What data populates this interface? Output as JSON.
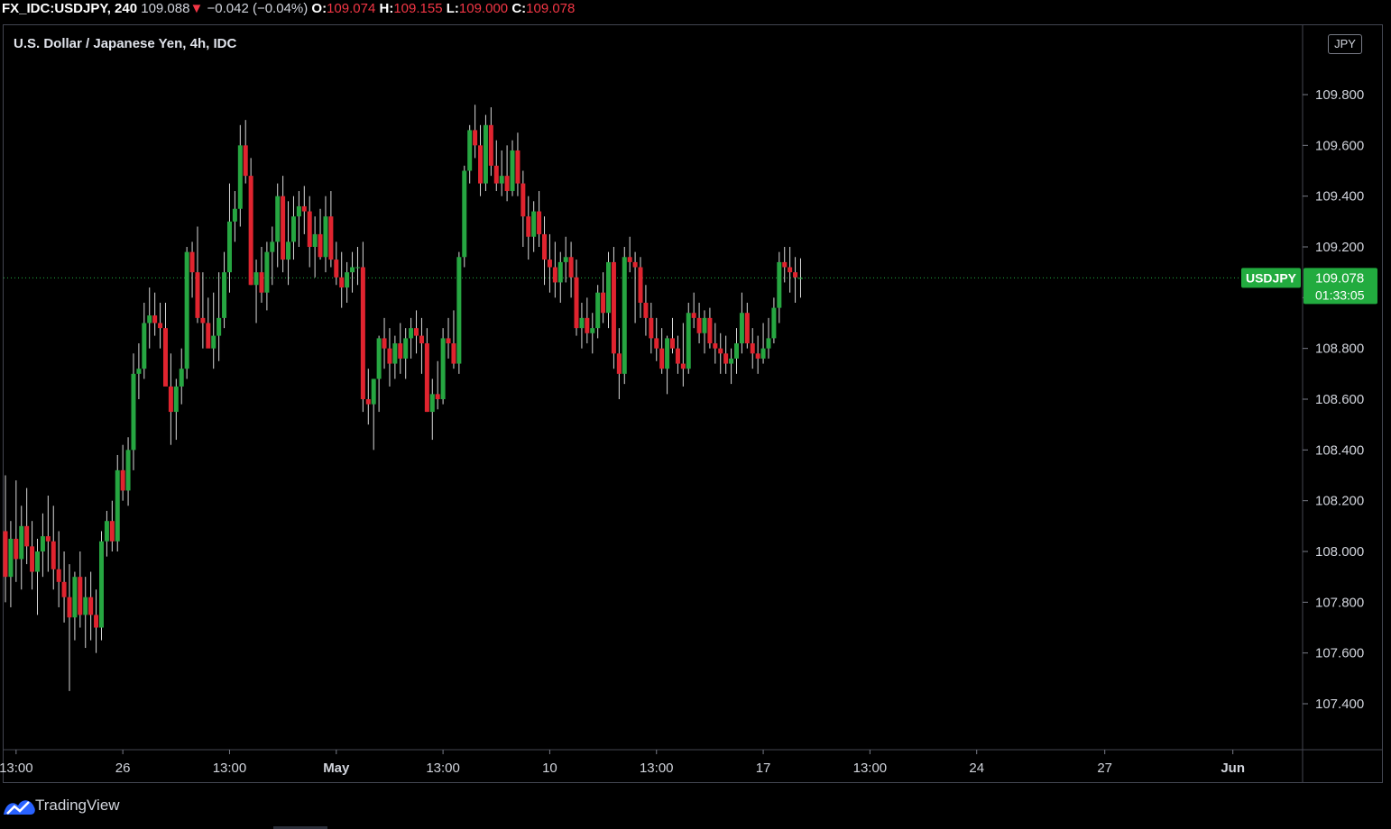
{
  "header": {
    "symbol": "FX_IDC:USDJPY, 240",
    "last": "109.088",
    "arrow": "▼",
    "change": "−0.042 (−0.04%)",
    "o_label": "O:",
    "o": "109.074",
    "h_label": "H:",
    "h": "109.155",
    "l_label": "L:",
    "l": "109.000",
    "c_label": "C:",
    "c": "109.078"
  },
  "chart_title": "U.S. Dollar / Japanese Yen, 4h, IDC",
  "currency_badge": "JPY",
  "brand": "TradingView",
  "colors": {
    "up": "#26a641",
    "down": "#e0242f",
    "wick": "#d9d9d9",
    "badge": "#22ab3f",
    "background": "#000000"
  },
  "chart_data": {
    "type": "candlestick",
    "ylim": [
      107.2,
      110.0
    ],
    "yticks": [
      107.4,
      107.6,
      107.8,
      108.0,
      108.2,
      108.4,
      108.6,
      108.8,
      109.0,
      109.2,
      109.4,
      109.6,
      109.8
    ],
    "ytick_labels": [
      "107.400",
      "107.600",
      "107.800",
      "108.000",
      "108.200",
      "108.400",
      "108.600",
      "108.800",
      "109.000",
      "109.200",
      "109.400",
      "109.600",
      "109.800"
    ],
    "xticks": [
      {
        "label": "13:00",
        "i": 2
      },
      {
        "label": "26",
        "i": 22
      },
      {
        "label": "13:00",
        "i": 42
      },
      {
        "label": "May",
        "i": 62
      },
      {
        "label": "13:00",
        "i": 82
      },
      {
        "label": "10",
        "i": 102
      },
      {
        "label": "13:00",
        "i": 122
      },
      {
        "label": "17",
        "i": 142
      },
      {
        "label": "13:00",
        "i": 162
      },
      {
        "label": "24",
        "i": 182
      },
      {
        "label": "27",
        "i": 206
      },
      {
        "label": "Jun",
        "i": 230
      }
    ],
    "last_price": {
      "symbol": "USDJPY",
      "value": "109.078",
      "countdown": "01:33:05",
      "y": 109.078
    },
    "candles": [
      [
        108.08,
        108.3,
        107.8,
        107.9
      ],
      [
        107.9,
        108.12,
        107.78,
        108.05
      ],
      [
        108.05,
        108.28,
        107.88,
        107.97
      ],
      [
        107.97,
        108.18,
        107.85,
        108.1
      ],
      [
        108.1,
        108.25,
        107.95,
        108.02
      ],
      [
        108.02,
        108.12,
        107.85,
        107.92
      ],
      [
        107.92,
        108.05,
        107.75,
        108.0
      ],
      [
        108.0,
        108.15,
        107.9,
        108.06
      ],
      [
        108.06,
        108.22,
        107.92,
        108.04
      ],
      [
        108.04,
        108.18,
        107.85,
        107.93
      ],
      [
        107.93,
        108.08,
        107.78,
        107.88
      ],
      [
        107.88,
        108.0,
        107.72,
        107.82
      ],
      [
        107.82,
        107.95,
        107.45,
        107.74
      ],
      [
        107.74,
        107.92,
        107.65,
        107.9
      ],
      [
        107.9,
        108.0,
        107.7,
        107.75
      ],
      [
        107.75,
        107.9,
        107.62,
        107.82
      ],
      [
        107.82,
        107.92,
        107.65,
        107.75
      ],
      [
        107.75,
        107.85,
        107.6,
        107.7
      ],
      [
        107.7,
        108.08,
        107.65,
        108.04
      ],
      [
        108.04,
        108.16,
        107.98,
        108.12
      ],
      [
        108.12,
        108.2,
        108.0,
        108.04
      ],
      [
        108.04,
        108.38,
        108.0,
        108.32
      ],
      [
        108.32,
        108.42,
        108.2,
        108.24
      ],
      [
        108.24,
        108.45,
        108.18,
        108.4
      ],
      [
        108.4,
        108.78,
        108.32,
        108.7
      ],
      [
        108.7,
        108.82,
        108.6,
        108.72
      ],
      [
        108.72,
        108.98,
        108.68,
        108.9
      ],
      [
        108.9,
        109.04,
        108.8,
        108.93
      ],
      [
        108.93,
        109.02,
        108.85,
        108.9
      ],
      [
        108.9,
        108.98,
        108.8,
        108.88
      ],
      [
        108.88,
        108.98,
        108.72,
        108.65
      ],
      [
        108.65,
        108.78,
        108.42,
        108.55
      ],
      [
        108.55,
        108.68,
        108.44,
        108.65
      ],
      [
        108.65,
        108.8,
        108.58,
        108.72
      ],
      [
        108.72,
        109.2,
        108.68,
        109.18
      ],
      [
        109.18,
        109.22,
        109.0,
        109.1
      ],
      [
        109.1,
        109.28,
        108.9,
        108.92
      ],
      [
        108.92,
        109.1,
        108.8,
        108.9
      ],
      [
        108.9,
        109.0,
        108.82,
        108.8
      ],
      [
        108.8,
        109.02,
        108.72,
        108.85
      ],
      [
        108.85,
        109.1,
        108.75,
        108.92
      ],
      [
        108.92,
        109.18,
        108.88,
        109.1
      ],
      [
        109.1,
        109.45,
        109.02,
        109.3
      ],
      [
        109.3,
        109.42,
        109.22,
        109.35
      ],
      [
        109.35,
        109.68,
        109.28,
        109.6
      ],
      [
        109.6,
        109.7,
        109.45,
        109.48
      ],
      [
        109.48,
        109.55,
        109.05,
        109.05
      ],
      [
        109.05,
        109.15,
        108.9,
        109.1
      ],
      [
        109.1,
        109.2,
        108.98,
        109.02
      ],
      [
        109.02,
        109.22,
        108.95,
        109.18
      ],
      [
        109.18,
        109.28,
        109.05,
        109.22
      ],
      [
        109.22,
        109.45,
        109.12,
        109.4
      ],
      [
        109.4,
        109.48,
        109.1,
        109.15
      ],
      [
        109.15,
        109.38,
        109.05,
        109.22
      ],
      [
        109.22,
        109.4,
        109.15,
        109.32
      ],
      [
        109.32,
        109.42,
        109.2,
        109.36
      ],
      [
        109.36,
        109.44,
        109.25,
        109.34
      ],
      [
        109.34,
        109.4,
        109.12,
        109.2
      ],
      [
        109.2,
        109.32,
        109.08,
        109.25
      ],
      [
        109.25,
        109.35,
        109.15,
        109.16
      ],
      [
        109.16,
        109.4,
        109.1,
        109.32
      ],
      [
        109.32,
        109.42,
        109.12,
        109.15
      ],
      [
        109.15,
        109.22,
        109.05,
        109.08
      ],
      [
        109.08,
        109.18,
        108.96,
        109.04
      ],
      [
        109.04,
        109.14,
        108.98,
        109.1
      ],
      [
        109.1,
        109.18,
        109.02,
        109.12
      ],
      [
        109.12,
        109.2,
        109.05,
        109.12
      ],
      [
        109.12,
        109.22,
        108.55,
        108.6
      ],
      [
        108.6,
        108.72,
        108.5,
        108.58
      ],
      [
        108.58,
        108.68,
        108.4,
        108.68
      ],
      [
        108.68,
        108.85,
        108.55,
        108.84
      ],
      [
        108.84,
        108.92,
        108.72,
        108.8
      ],
      [
        108.8,
        108.88,
        108.65,
        108.74
      ],
      [
        108.74,
        108.85,
        108.68,
        108.82
      ],
      [
        108.82,
        108.9,
        108.7,
        108.76
      ],
      [
        108.76,
        108.88,
        108.68,
        108.84
      ],
      [
        108.84,
        108.92,
        108.76,
        108.88
      ],
      [
        108.88,
        108.95,
        108.78,
        108.85
      ],
      [
        108.85,
        108.92,
        108.7,
        108.82
      ],
      [
        108.82,
        108.88,
        108.55,
        108.55
      ],
      [
        108.55,
        108.68,
        108.44,
        108.62
      ],
      [
        108.62,
        108.75,
        108.56,
        108.6
      ],
      [
        108.6,
        108.88,
        108.58,
        108.84
      ],
      [
        108.84,
        108.92,
        108.76,
        108.82
      ],
      [
        108.82,
        108.95,
        108.72,
        108.74
      ],
      [
        108.74,
        109.18,
        108.7,
        109.16
      ],
      [
        109.16,
        109.52,
        109.12,
        109.5
      ],
      [
        109.5,
        109.68,
        109.45,
        109.66
      ],
      [
        109.66,
        109.76,
        109.55,
        109.6
      ],
      [
        109.6,
        109.68,
        109.4,
        109.45
      ],
      [
        109.45,
        109.72,
        109.42,
        109.68
      ],
      [
        109.68,
        109.75,
        109.48,
        109.52
      ],
      [
        109.52,
        109.62,
        109.42,
        109.45
      ],
      [
        109.45,
        109.58,
        109.4,
        109.48
      ],
      [
        109.48,
        109.6,
        109.38,
        109.42
      ],
      [
        109.42,
        109.62,
        109.4,
        109.58
      ],
      [
        109.58,
        109.65,
        109.4,
        109.45
      ],
      [
        109.45,
        109.5,
        109.2,
        109.32
      ],
      [
        109.32,
        109.4,
        109.15,
        109.24
      ],
      [
        109.24,
        109.38,
        109.18,
        109.34
      ],
      [
        109.34,
        109.42,
        109.2,
        109.25
      ],
      [
        109.25,
        109.32,
        109.05,
        109.15
      ],
      [
        109.15,
        109.25,
        109.02,
        109.12
      ],
      [
        109.12,
        109.22,
        109.0,
        109.06
      ],
      [
        109.06,
        109.18,
        108.98,
        109.14
      ],
      [
        109.14,
        109.24,
        109.06,
        109.16
      ],
      [
        109.16,
        109.22,
        109.0,
        109.08
      ],
      [
        109.08,
        109.15,
        108.85,
        108.88
      ],
      [
        108.88,
        108.98,
        108.8,
        108.92
      ],
      [
        108.92,
        109.0,
        108.82,
        108.86
      ],
      [
        108.86,
        108.94,
        108.78,
        108.88
      ],
      [
        108.88,
        109.05,
        108.84,
        109.02
      ],
      [
        109.02,
        109.1,
        108.9,
        108.94
      ],
      [
        108.94,
        109.18,
        108.88,
        109.14
      ],
      [
        109.14,
        109.2,
        108.72,
        108.78
      ],
      [
        108.78,
        108.88,
        108.6,
        108.7
      ],
      [
        108.7,
        109.2,
        108.66,
        109.16
      ],
      [
        109.16,
        109.24,
        109.1,
        109.14
      ],
      [
        109.14,
        109.18,
        108.9,
        109.12
      ],
      [
        109.12,
        109.16,
        108.92,
        108.98
      ],
      [
        108.98,
        109.05,
        108.85,
        108.92
      ],
      [
        108.92,
        108.98,
        108.78,
        108.84
      ],
      [
        108.84,
        108.92,
        108.75,
        108.8
      ],
      [
        108.8,
        108.88,
        108.7,
        108.72
      ],
      [
        108.72,
        108.85,
        108.62,
        108.84
      ],
      [
        108.84,
        108.92,
        108.78,
        108.8
      ],
      [
        108.8,
        108.85,
        108.7,
        108.74
      ],
      [
        108.74,
        108.9,
        108.65,
        108.72
      ],
      [
        108.72,
        108.98,
        108.7,
        108.94
      ],
      [
        108.94,
        109.02,
        108.88,
        108.92
      ],
      [
        108.92,
        108.98,
        108.82,
        108.86
      ],
      [
        108.86,
        108.95,
        108.78,
        108.92
      ],
      [
        108.92,
        108.96,
        108.8,
        108.82
      ],
      [
        108.82,
        108.9,
        108.74,
        108.8
      ],
      [
        108.8,
        108.86,
        108.7,
        108.78
      ],
      [
        108.78,
        108.85,
        108.7,
        108.74
      ],
      [
        108.74,
        108.8,
        108.66,
        108.76
      ],
      [
        108.76,
        108.88,
        108.7,
        108.82
      ],
      [
        108.82,
        109.02,
        108.78,
        108.94
      ],
      [
        108.94,
        108.98,
        108.8,
        108.82
      ],
      [
        108.82,
        108.88,
        108.72,
        108.78
      ],
      [
        108.78,
        108.85,
        108.7,
        108.76
      ],
      [
        108.76,
        108.9,
        108.74,
        108.8
      ],
      [
        108.8,
        108.92,
        108.76,
        108.84
      ],
      [
        108.84,
        109.0,
        108.82,
        108.96
      ],
      [
        108.96,
        109.18,
        108.9,
        109.14
      ],
      [
        109.14,
        109.2,
        109.06,
        109.12
      ],
      [
        109.12,
        109.2,
        109.02,
        109.1
      ],
      [
        109.1,
        109.16,
        108.98,
        109.08
      ],
      [
        109.074,
        109.155,
        109.0,
        109.078
      ]
    ]
  }
}
